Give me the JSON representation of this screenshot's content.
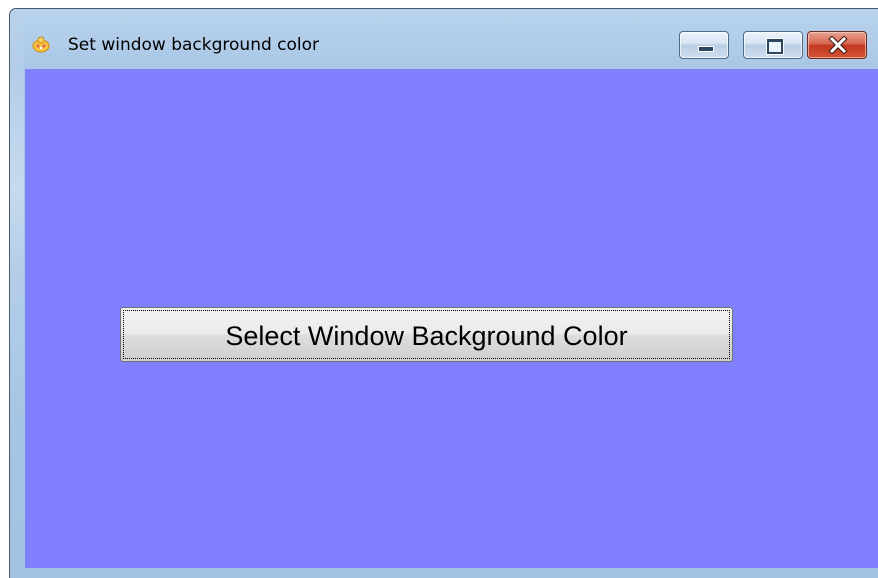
{
  "window": {
    "title": "Set window background color",
    "icon": "app-icon",
    "background_color": "#8080ff",
    "caption_buttons": {
      "minimize_icon": "minimize-icon",
      "maximize_icon": "restore-icon",
      "close_icon": "close-icon"
    }
  },
  "main": {
    "button_label": "Select Window Background Color"
  }
}
